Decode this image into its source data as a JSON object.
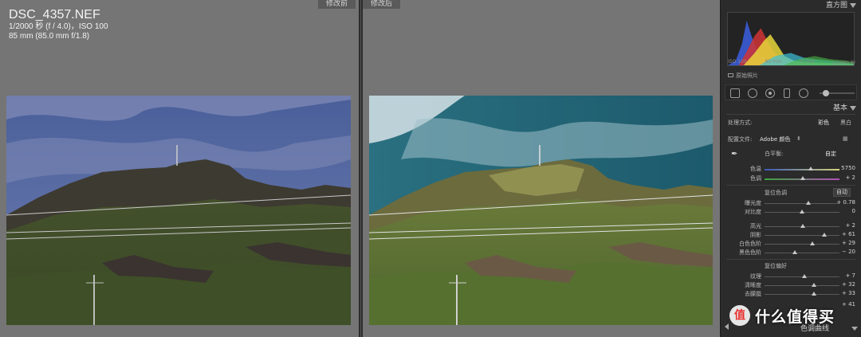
{
  "left_view": {
    "tag": "修改前",
    "file_name": "DSC_4357.NEF",
    "exposure_line": "1/2000 秒 (f / 4.0)，ISO 100",
    "lens_line": "85 mm (85.0 mm f/1.8)"
  },
  "right_view": {
    "tag": "修改后"
  },
  "panel": {
    "histogram": {
      "title": "直方图",
      "meta": [
        "ISO 100",
        "85 mm",
        "f / 4.0",
        "1/2000 秒"
      ],
      "original_photo": "原始照片"
    },
    "basic": {
      "title": "基本",
      "treatment_label": "处理方式:",
      "treatment_color": "彩色",
      "treatment_bw": "黑白",
      "profile_label": "配置文件:",
      "profile_value": "Adobe 颜色",
      "wb_label": "白平衡:",
      "wb_value": "自定",
      "temp": {
        "label": "色温",
        "value": "5750",
        "pos": 0.62
      },
      "tint": {
        "label": "色调",
        "value": "+ 2",
        "pos": 0.51
      },
      "tone_group": "复位色调",
      "auto": "自动",
      "exposure": {
        "label": "曝光度",
        "value": "+ 0.78",
        "pos": 0.58
      },
      "contrast": {
        "label": "对比度",
        "value": "0",
        "pos": 0.5
      },
      "highlights": {
        "label": "高光",
        "value": "+ 2",
        "pos": 0.51
      },
      "shadows": {
        "label": "阴影",
        "value": "+ 61",
        "pos": 0.8
      },
      "whites": {
        "label": "白色色阶",
        "value": "+ 29",
        "pos": 0.64
      },
      "blacks": {
        "label": "黑色色阶",
        "value": "− 20",
        "pos": 0.4
      },
      "presence_group": "复位偏好",
      "texture": {
        "label": "纹理",
        "value": "+ 7",
        "pos": 0.53
      },
      "clarity": {
        "label": "清晰度",
        "value": "+ 32",
        "pos": 0.66
      },
      "dehaze": {
        "label": "去朦胧",
        "value": "+ 33",
        "pos": 0.66
      },
      "vibrance_value": "+ 41"
    },
    "tone_curve": {
      "title": "色调曲线"
    }
  },
  "watermark": {
    "badge": "值",
    "text": "什么值得买"
  },
  "colors": {
    "bg": "#757575",
    "panel": "#2b2b2b",
    "accent": "#e8322f"
  }
}
